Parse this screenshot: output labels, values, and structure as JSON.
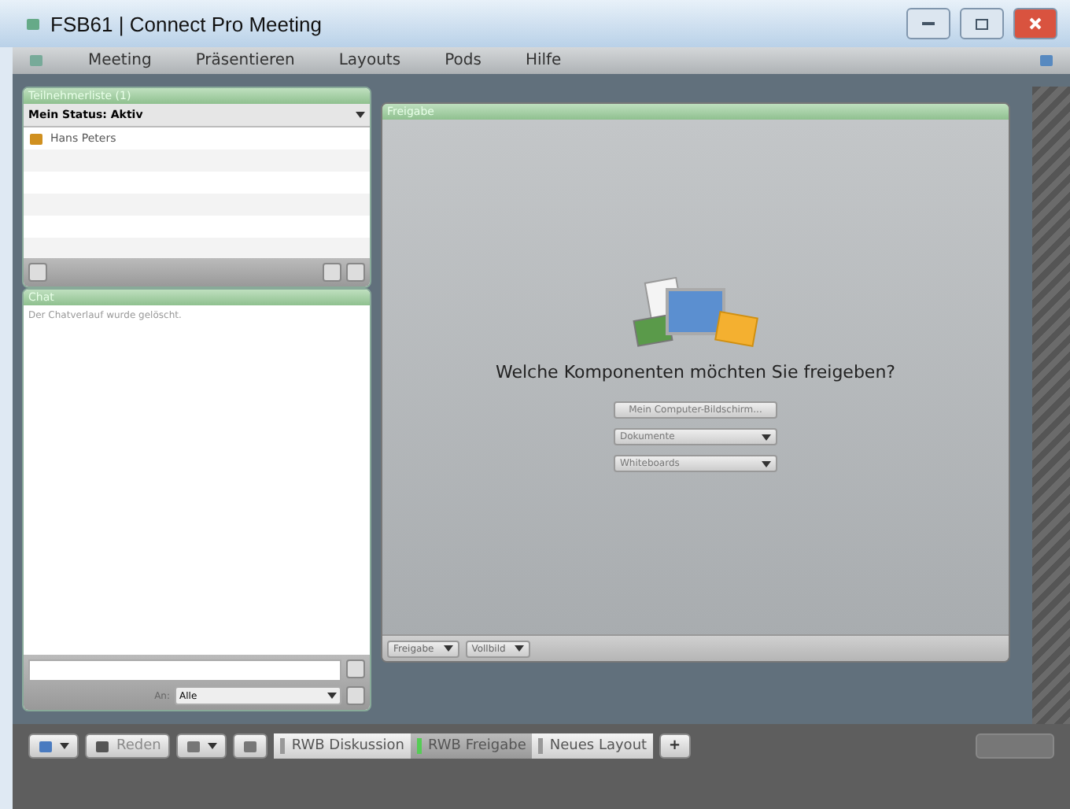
{
  "window": {
    "title": "FSB61 | Connect Pro Meeting"
  },
  "menu": [
    "Meeting",
    "Präsentieren",
    "Layouts",
    "Pods",
    "Hilfe"
  ],
  "attendees": {
    "title": "Teilnehmerliste (1)",
    "status": "Mein Status: Aktiv",
    "people": [
      "Hans Peters"
    ]
  },
  "chat": {
    "title": "Chat",
    "message": "Der Chatverlauf wurde gelöscht.",
    "to_label": "An:",
    "to_value": "Alle"
  },
  "share": {
    "title": "Freigabe",
    "question": "Welche Komponenten möchten Sie freigeben?",
    "options": [
      {
        "kind": "button",
        "label": "Mein Computer-Bildschirm..."
      },
      {
        "kind": "dropdown",
        "label": "Dokumente"
      },
      {
        "kind": "dropdown",
        "label": "Whiteboards"
      }
    ],
    "footer": [
      "Freigabe",
      "Vollbild"
    ]
  },
  "toolbar": {
    "talk": "Reden"
  },
  "layouts": [
    {
      "label": "RWB Diskussion",
      "selected": false
    },
    {
      "label": "RWB Freigabe",
      "selected": true
    },
    {
      "label": "Neues Layout",
      "selected": false
    }
  ],
  "add_layout": "+"
}
